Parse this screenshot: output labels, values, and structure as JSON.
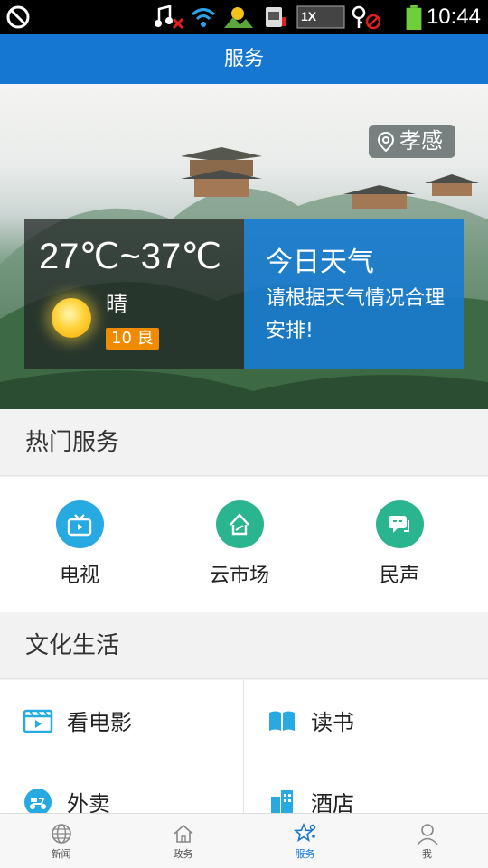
{
  "status_bar": {
    "time": "10:44"
  },
  "header": {
    "title": "服务"
  },
  "banner": {
    "location": "孝感",
    "weather": {
      "temperature": "27℃~37℃",
      "condition": "晴",
      "aqi": "10 良",
      "panel_title": "今日天气",
      "advice": "请根据天气情况合理安排!"
    }
  },
  "hot_services": {
    "title": "热门服务",
    "items": [
      {
        "label": "电视",
        "icon": "tv-icon",
        "color": "#27a9e1"
      },
      {
        "label": "云市场",
        "icon": "market-icon",
        "color": "#2bb58f"
      },
      {
        "label": "民声",
        "icon": "chat-icon",
        "color": "#2bb58f"
      }
    ]
  },
  "culture_life": {
    "title": "文化生活",
    "items": [
      {
        "label": "看电影",
        "icon": "film-icon"
      },
      {
        "label": "读书",
        "icon": "book-icon"
      },
      {
        "label": "外卖",
        "icon": "scooter-icon"
      },
      {
        "label": "酒店",
        "icon": "hotel-icon"
      }
    ]
  },
  "tabbar": {
    "tabs": [
      {
        "label": "新闻",
        "icon": "globe-icon"
      },
      {
        "label": "政务",
        "icon": "home-icon"
      },
      {
        "label": "服务",
        "icon": "star-icon",
        "active": true
      },
      {
        "label": "我",
        "icon": "user-icon"
      }
    ]
  },
  "colors": {
    "primary": "#1677d2",
    "accent_orange": "#f08a00"
  }
}
